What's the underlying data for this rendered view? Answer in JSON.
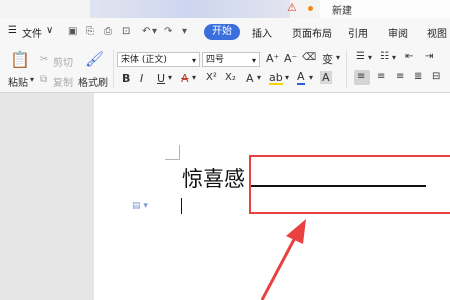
{
  "titlebar": {
    "doc_tab_label": "新建"
  },
  "menu": {
    "file_label": "文件",
    "tabs": [
      "开始",
      "插入",
      "页面布局",
      "引用",
      "审阅",
      "视图"
    ]
  },
  "ribbon": {
    "paste_label": "粘贴",
    "cut_label": "剪切",
    "copy_label": "复制",
    "format_painter_label": "格式刷",
    "font_name": "宋体 (正文)",
    "font_size": "四号",
    "bold": "B",
    "italic": "I",
    "underline": "U",
    "font_color": "A",
    "superscript": "X²",
    "subscript": "X₂",
    "grow_font": "A⁺",
    "shrink_font": "A⁻",
    "phonetic": "变",
    "char_shading": "A",
    "highlight": "ab",
    "text_color": "A"
  },
  "document": {
    "text": "惊喜感"
  },
  "colors": {
    "accent": "#3b6fde",
    "highlight_box": "#e94040"
  }
}
